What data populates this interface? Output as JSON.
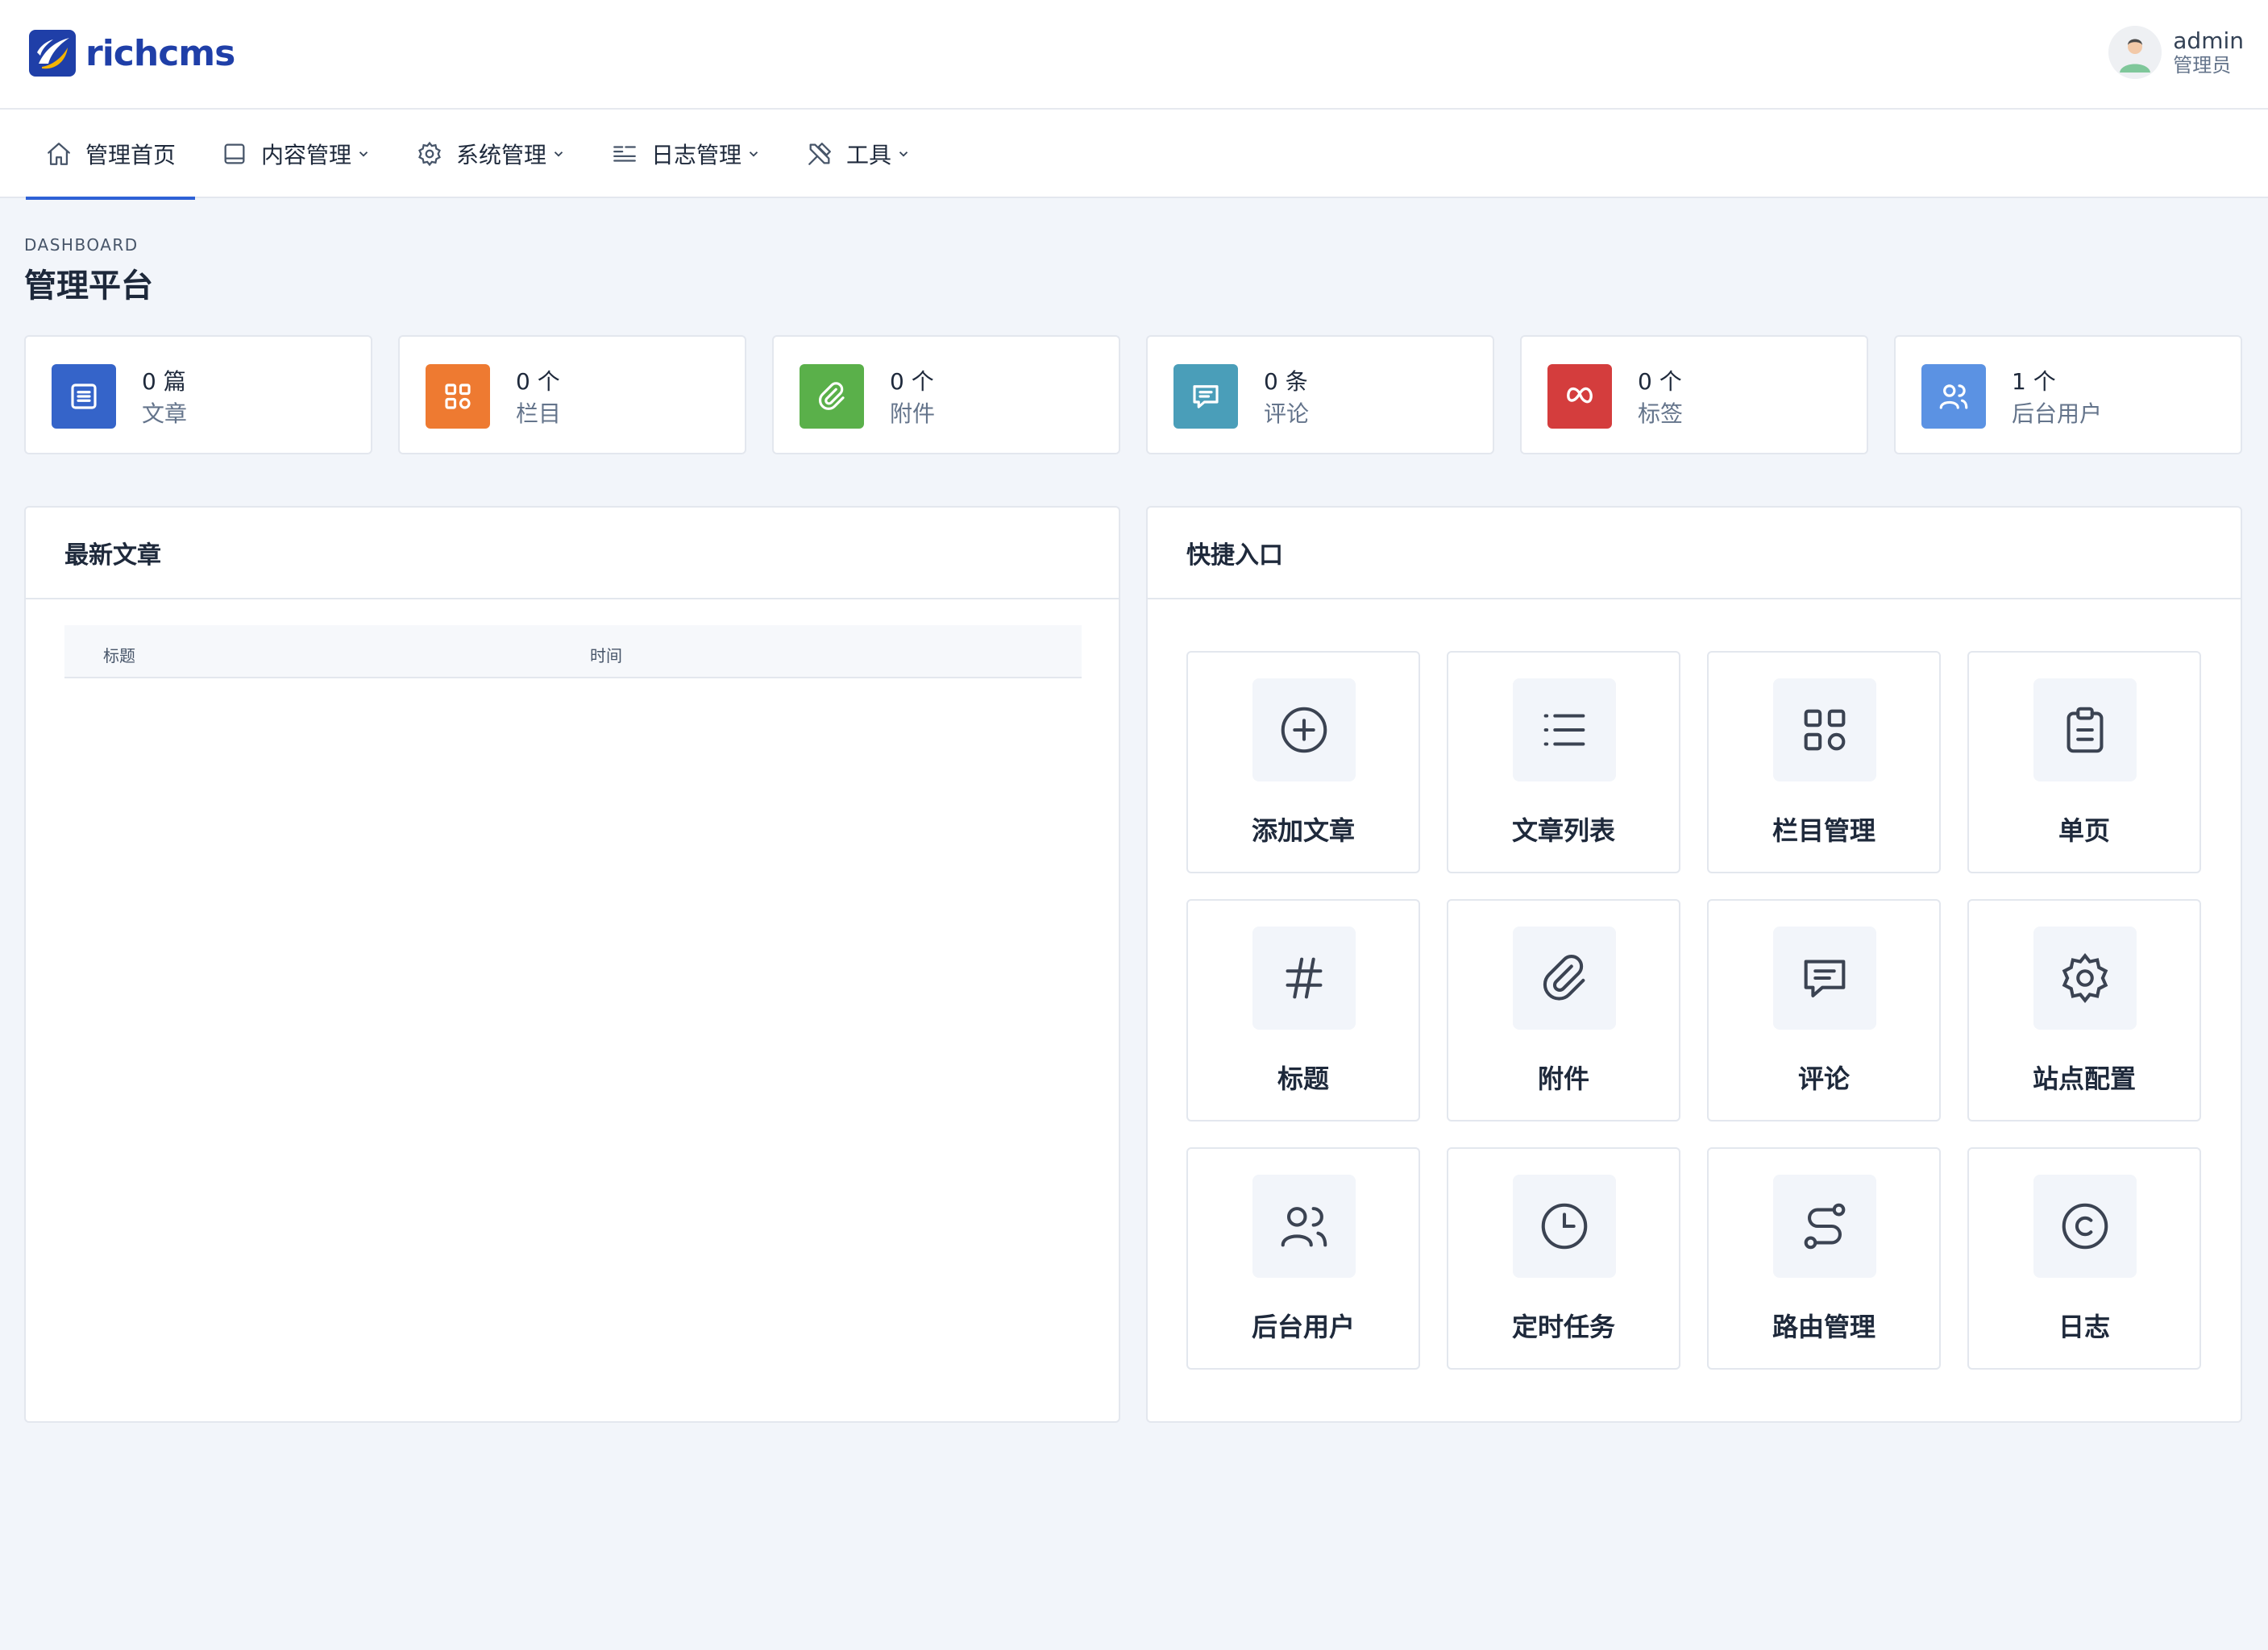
{
  "brand": {
    "name": "richcms",
    "accent": "#2e61d6"
  },
  "user": {
    "name": "admin",
    "role": "管理员"
  },
  "nav": [
    {
      "label": "管理首页",
      "icon": "home-icon",
      "dropdown": false,
      "active": true
    },
    {
      "label": "内容管理",
      "icon": "layout-icon",
      "dropdown": true,
      "active": false
    },
    {
      "label": "系统管理",
      "icon": "gear-icon",
      "dropdown": true,
      "active": false
    },
    {
      "label": "日志管理",
      "icon": "log-lines-icon",
      "dropdown": true,
      "active": false
    },
    {
      "label": "工具",
      "icon": "tools-icon",
      "dropdown": true,
      "active": false
    }
  ],
  "page": {
    "pretitle": "DASHBOARD",
    "title": "管理平台"
  },
  "stats": [
    {
      "count": "0 篇",
      "label": "文章",
      "color": "#3564c9",
      "icon": "article-icon"
    },
    {
      "count": "0 个",
      "label": "栏目",
      "color": "#ee7a31",
      "icon": "grid-icon"
    },
    {
      "count": "0 个",
      "label": "附件",
      "color": "#5ab04a",
      "icon": "paperclip-icon"
    },
    {
      "count": "0 条",
      "label": "评论",
      "color": "#4a9eb9",
      "icon": "comment-icon"
    },
    {
      "count": "0 个",
      "label": "标签",
      "color": "#d43d3d",
      "icon": "meta-icon"
    },
    {
      "count": "1 个",
      "label": "后台用户",
      "color": "#5b92e3",
      "icon": "users-icon"
    }
  ],
  "latest": {
    "title": "最新文章",
    "columns": [
      "标题",
      "时间"
    ],
    "rows": []
  },
  "quick": {
    "title": "快捷入口",
    "items": [
      {
        "label": "添加文章",
        "icon": "plus-circle-icon"
      },
      {
        "label": "文章列表",
        "icon": "list-icon"
      },
      {
        "label": "栏目管理",
        "icon": "grid-icon"
      },
      {
        "label": "单页",
        "icon": "clipboard-icon"
      },
      {
        "label": "标题",
        "icon": "hash-icon"
      },
      {
        "label": "附件",
        "icon": "paperclip-icon"
      },
      {
        "label": "评论",
        "icon": "comment-icon"
      },
      {
        "label": "站点配置",
        "icon": "gear-icon"
      },
      {
        "label": "后台用户",
        "icon": "users-icon"
      },
      {
        "label": "定时任务",
        "icon": "clock-icon"
      },
      {
        "label": "路由管理",
        "icon": "route-icon"
      },
      {
        "label": "日志",
        "icon": "copyright-icon"
      }
    ]
  }
}
